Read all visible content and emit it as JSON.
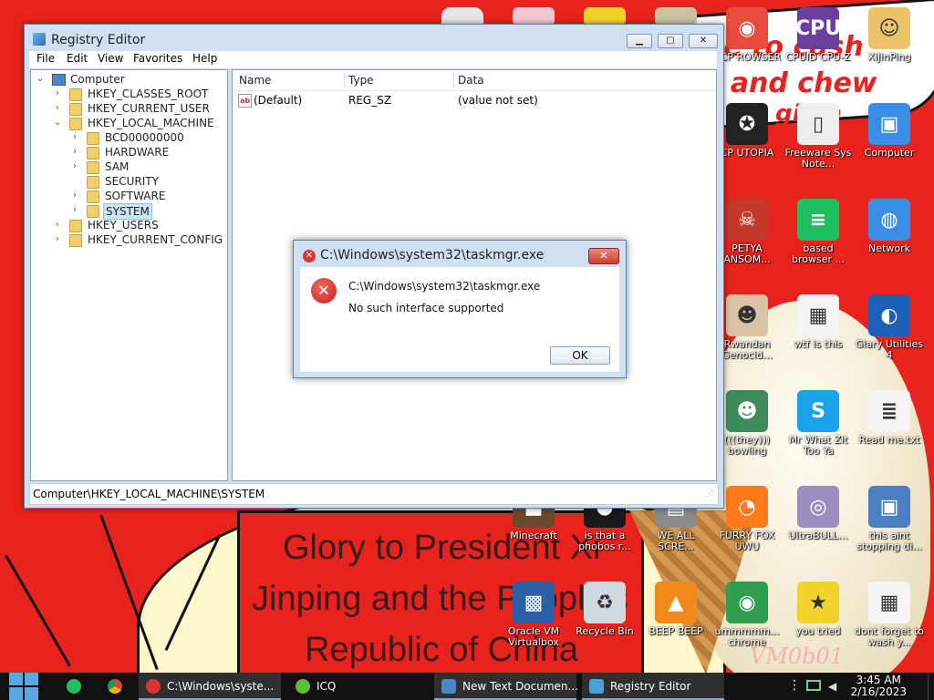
{
  "wallpaper": {
    "bubble_line1": "me to cash",
    "bubble_line2": "e and chew",
    "bubble_line3": "gillin",
    "caption_line1": "Glory to President Xi",
    "caption_line2": "Jinping and the People's",
    "caption_line3": "Republic of China",
    "watermark": "VM0b01"
  },
  "desktop_icons": [
    {
      "label": "CCP ROWSER",
      "icon": "ccp-browser-icon",
      "color": "#e74c3c"
    },
    {
      "label": "CPUID CPU-Z",
      "icon": "cpu-z-icon",
      "color": "#6b3fa0"
    },
    {
      "label": "XiJinPing",
      "icon": "user-folder-icon",
      "color": "#e9c46a"
    },
    {
      "label": "CP UTOPIA",
      "icon": "ccp-utopia-icon",
      "color": "#222222"
    },
    {
      "label": "Freeware Sys Note...",
      "icon": "blank-file-icon",
      "color": "#eeeeee"
    },
    {
      "label": "Computer",
      "icon": "computer-icon",
      "color": "#3a8ee6"
    },
    {
      "label": "PETYA ANSOM...",
      "icon": "skull-icon",
      "color": "#c0392b"
    },
    {
      "label": "based browser ...",
      "icon": "chat-bubble-icon",
      "color": "#1fbf5f"
    },
    {
      "label": "Network",
      "icon": "network-icon",
      "color": "#3a8ee6"
    },
    {
      "label": "Rwandan Genocid...",
      "icon": "face-icon",
      "color": "#d9c3a5"
    },
    {
      "label": "wtf is this",
      "icon": "calendar-file-icon",
      "color": "#f5f5f5"
    },
    {
      "label": "Glary Utilities 4",
      "icon": "glary-icon",
      "color": "#1b5fb8"
    },
    {
      "label": "(((they))) bowling",
      "icon": "goblin-icon",
      "color": "#3d8b5a"
    },
    {
      "label": "Mr What Zit Too Ya",
      "icon": "skype-icon",
      "color": "#1aa3e8"
    },
    {
      "label": "Read me.txt",
      "icon": "text-file-icon",
      "color": "#f5f5f5"
    },
    {
      "label": "Minecraft",
      "icon": "minecraft-icon",
      "color": "#6b4a2b"
    },
    {
      "label": "is that a phobos r...",
      "icon": "phobos-icon",
      "color": "#1a1a1a"
    },
    {
      "label": "WE ALL SCRE...",
      "icon": "computer-old-icon",
      "color": "#8a8a8a"
    },
    {
      "label": "FURRY FOX UWU",
      "icon": "firefox-icon",
      "color": "#ff7a1a"
    },
    {
      "label": "UltraBULL...",
      "icon": "disc-icon",
      "color": "#9c8fbf"
    },
    {
      "label": "this aint stopping di...",
      "icon": "computer-setup-icon",
      "color": "#4a7fc1"
    },
    {
      "label": "Oracle VM Virtualbox",
      "icon": "virtualbox-icon",
      "color": "#2b5fa8"
    },
    {
      "label": "Recycle Bin",
      "icon": "recycle-bin-icon",
      "color": "#d0d8e0"
    },
    {
      "label": "BEEP BEEP",
      "icon": "vlc-icon",
      "color": "#f08a1a"
    },
    {
      "label": "ummmmm... chrome",
      "icon": "chrome-icon",
      "color": "#2f9e4f"
    },
    {
      "label": "you tried",
      "icon": "star-icon",
      "color": "#f2d32c"
    },
    {
      "label": "dont forget to wash y...",
      "icon": "calendar-file-icon",
      "color": "#f5f5f5"
    }
  ],
  "regedit": {
    "title": "Registry Editor",
    "menu": [
      "File",
      "Edit",
      "View",
      "Favorites",
      "Help"
    ],
    "min_glyph": "▁",
    "max_glyph": "▢",
    "close_glyph": "✕",
    "tree": {
      "root": "Computer",
      "hives": [
        "HKEY_CLASSES_ROOT",
        "HKEY_CURRENT_USER",
        "HKEY_LOCAL_MACHINE",
        "HKEY_USERS",
        "HKEY_CURRENT_CONFIG"
      ],
      "hklm_children": [
        "BCD00000000",
        "HARDWARE",
        "SAM",
        "SECURITY",
        "SOFTWARE",
        "SYSTEM"
      ],
      "selected": "SYSTEM"
    },
    "columns": [
      "Name",
      "Type",
      "Data"
    ],
    "values": [
      {
        "name": "(Default)",
        "type": "REG_SZ",
        "data": "(value not set)"
      }
    ],
    "status": "Computer\\HKEY_LOCAL_MACHINE\\SYSTEM"
  },
  "dialog": {
    "title": "C:\\Windows\\system32\\taskmgr.exe",
    "line1": "C:\\Windows\\system32\\taskmgr.exe",
    "line2": "No such interface supported",
    "ok_label": "OK"
  },
  "taskbar": {
    "items": [
      {
        "label": "C:\\Windows\\syste...",
        "icon": "error-icon",
        "color": "#d33"
      },
      {
        "label": "ICQ",
        "icon": "icq-icon",
        "color": "#5fbf3a"
      },
      {
        "label": "New Text Documen...",
        "icon": "notepad-icon",
        "color": "#4a86c8"
      },
      {
        "label": "Registry Editor",
        "icon": "regedit-icon",
        "color": "#4aa0d8"
      }
    ],
    "time": "3:45 AM",
    "date": "2/16/2023"
  }
}
